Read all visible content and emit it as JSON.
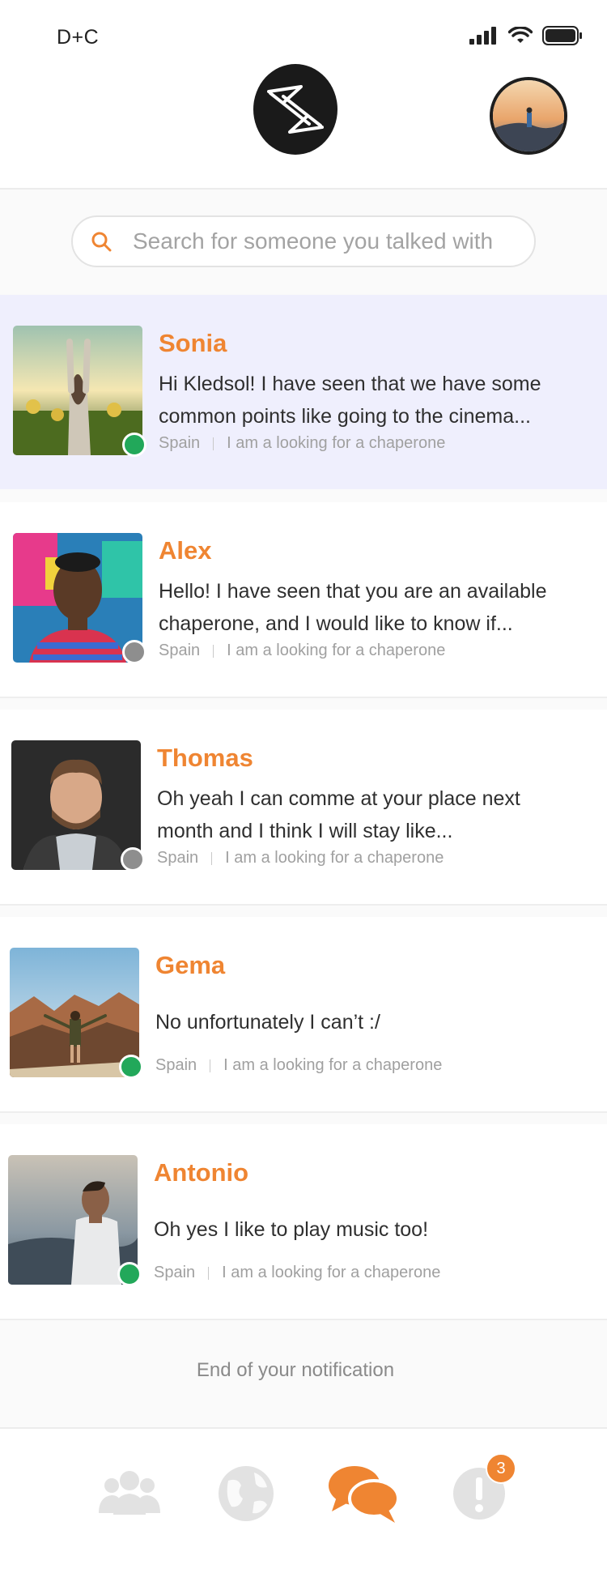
{
  "status_bar": {
    "carrier": "D+C"
  },
  "search": {
    "placeholder": "Search for someone you talked with"
  },
  "conversations": [
    {
      "name": "Sonia",
      "message": "Hi Kledsol! I have seen that we have some common points like going to the cinema...",
      "country": "Spain",
      "tag": "I am a looking for a chaperone",
      "status": "online",
      "active": true
    },
    {
      "name": "Alex",
      "message": "Hello! I have seen that you are an available chaperone, and I would like to know if...",
      "country": "Spain",
      "tag": "I am a looking for a chaperone",
      "status": "offline",
      "active": false
    },
    {
      "name": "Thomas",
      "message": "Oh yeah I can comme at your place next month and I think I will stay like...",
      "country": "Spain",
      "tag": "I am a looking for a chaperone",
      "status": "offline",
      "active": false
    },
    {
      "name": "Gema",
      "message": "No unfortunately I can’t :/",
      "country": "Spain",
      "tag": "I am a looking for a chaperone",
      "status": "online",
      "active": false
    },
    {
      "name": "Antonio",
      "message": "Oh yes I like to play music too!",
      "country": "Spain",
      "tag": "I am a looking for a chaperone",
      "status": "online",
      "active": false
    }
  ],
  "end_text": "End of your notification",
  "bottom_nav": {
    "items": [
      {
        "icon": "people-icon",
        "active": false
      },
      {
        "icon": "globe-icon",
        "active": false
      },
      {
        "icon": "chat-icon",
        "active": true
      },
      {
        "icon": "alert-icon",
        "active": false
      }
    ],
    "notification_count": "3"
  },
  "colors": {
    "accent": "#ef8532",
    "online": "#22a85a",
    "offline": "#8e8e8e",
    "active_row": "#efeffd"
  }
}
